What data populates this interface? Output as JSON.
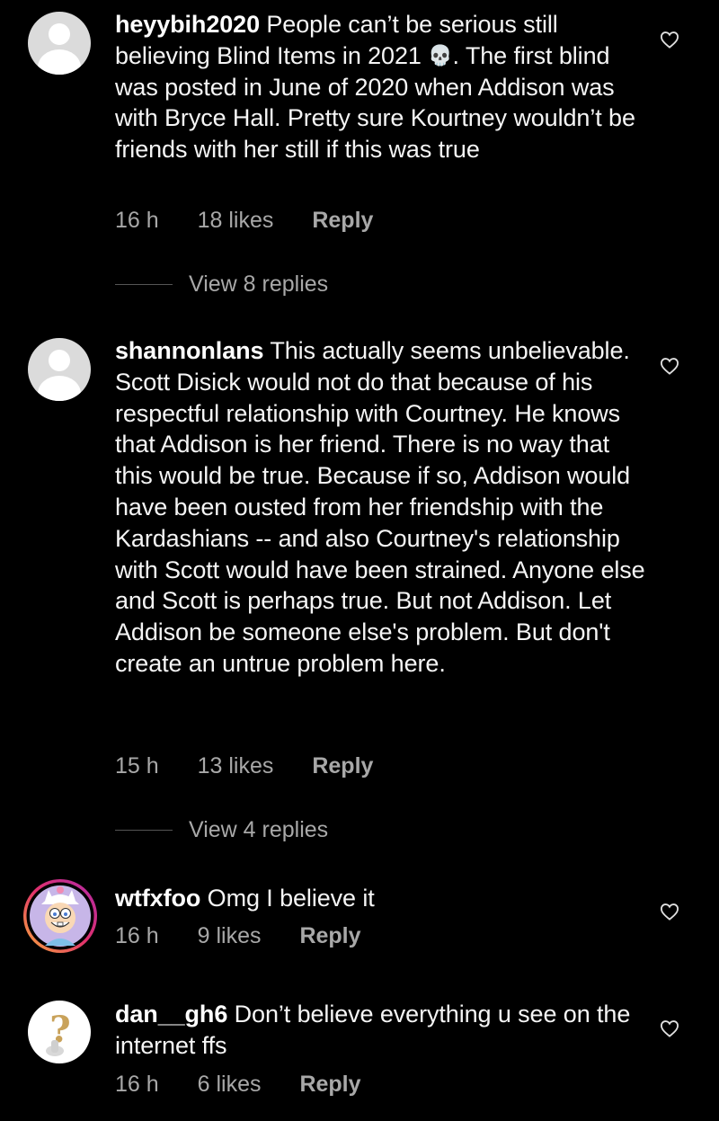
{
  "comments": [
    {
      "username": "heyybih2020",
      "text_before_emoji": " People can’t be serious still believing Blind Items in 2021 ",
      "emoji": "💀",
      "text_after_emoji": ". The first blind was posted in June of 2020 when Addison was with Bryce Hall. Pretty sure Kourtney wouldn’t be friends with her still if this was true",
      "time": "16 h",
      "likes": "18 likes",
      "reply": "Reply",
      "view_replies": "View 8 replies",
      "avatar": "default-avatar-icon"
    },
    {
      "username": "shannonlans",
      "text": " This actually seems unbelievable.  Scott Disick would not do that because of his respectful relationship with Courtney.  He knows that Addison is her friend.  There is no way that this would be true.  Because if so, Addison would have been ousted from her friendship with the Kardashians -- and also Courtney's relationship with Scott would have been strained.  Anyone else and Scott is perhaps true.  But not Addison.  Let Addison be someone else's problem.  But don't create an untrue problem here.",
      "time": "15 h",
      "likes": "13 likes",
      "reply": "Reply",
      "view_replies": "View 4 replies",
      "avatar": "default-avatar-icon"
    },
    {
      "username": "wtfxfoo",
      "text": " Omg I believe it",
      "time": "16 h",
      "likes": "9 likes",
      "reply": "Reply",
      "avatar": "cartoon-avatar-icon"
    },
    {
      "username": "dan__gh6",
      "text": " Don’t believe everything u see on the internet ffs",
      "time": "16 h",
      "likes": "6 likes",
      "reply": "Reply",
      "avatar": "question-mark-avatar-icon"
    }
  ],
  "colors": {
    "background": "#000000",
    "text": "#f5f5f5",
    "meta": "#a8a8a8",
    "story_ring": "#e1306c"
  }
}
